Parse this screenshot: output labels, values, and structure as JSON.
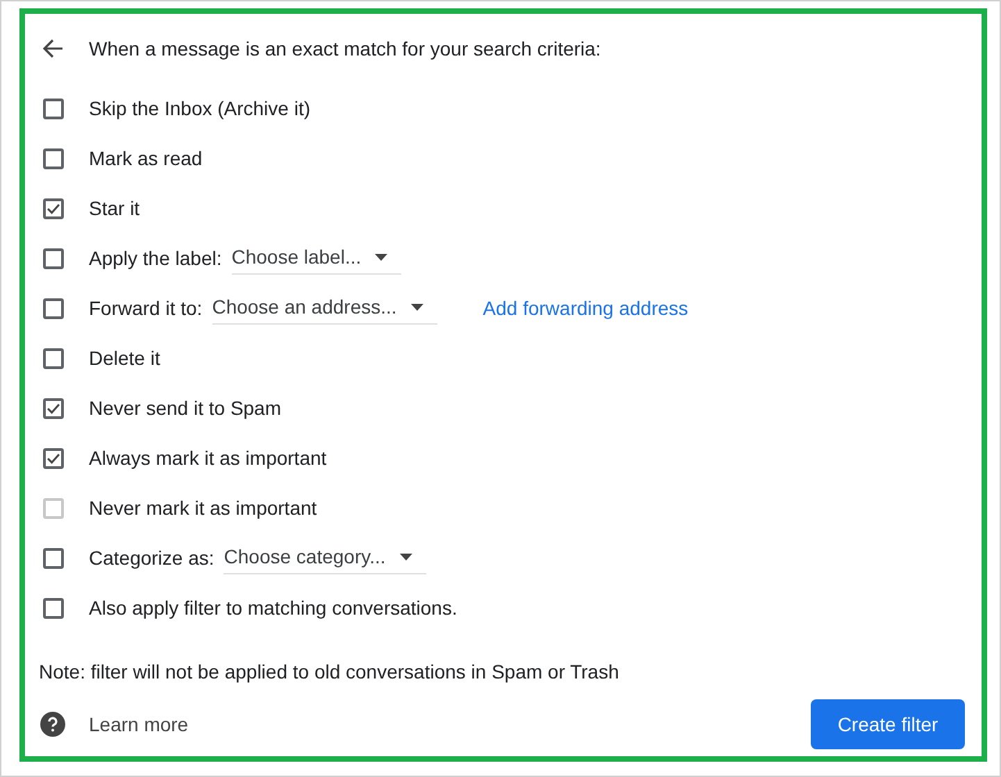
{
  "header": {
    "title": "When a message is an exact match for your search criteria:"
  },
  "actions": [
    {
      "label": "Skip the Inbox (Archive it)",
      "checked": false,
      "disabled": false
    },
    {
      "label": "Mark as read",
      "checked": false,
      "disabled": false
    },
    {
      "label": "Star it",
      "checked": true,
      "disabled": false
    },
    {
      "label": "Apply the label:",
      "checked": false,
      "disabled": false,
      "dropdown": {
        "value": "Choose label..."
      }
    },
    {
      "label": "Forward it to:",
      "checked": false,
      "disabled": false,
      "dropdown": {
        "value": "Choose an address..."
      },
      "link": "Add forwarding address"
    },
    {
      "label": "Delete it",
      "checked": false,
      "disabled": false
    },
    {
      "label": "Never send it to Spam",
      "checked": true,
      "disabled": false
    },
    {
      "label": "Always mark it as important",
      "checked": true,
      "disabled": false
    },
    {
      "label": "Never mark it as important",
      "checked": false,
      "disabled": true
    },
    {
      "label": "Categorize as:",
      "checked": false,
      "disabled": false,
      "dropdown": {
        "value": "Choose category..."
      }
    },
    {
      "label": "Also apply filter to matching conversations.",
      "checked": false,
      "disabled": false
    }
  ],
  "note": "Note: filter will not be applied to old conversations in Spam or Trash",
  "footer": {
    "help_link": "Learn more",
    "button": "Create filter"
  }
}
